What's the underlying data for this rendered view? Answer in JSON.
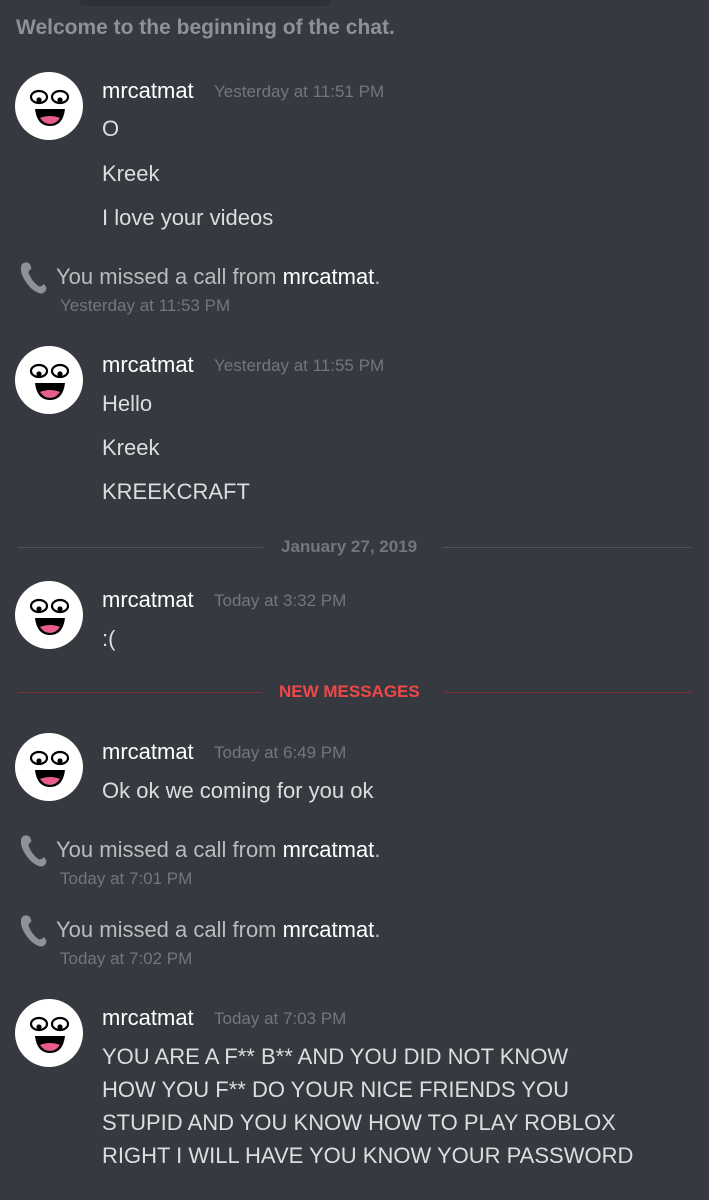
{
  "chat": {
    "welcome": "Welcome to the beginning of the chat."
  },
  "messages": [
    {
      "author": "mrcatmat",
      "timestamp": "Yesterday at 11:51 PM",
      "lines": [
        "O",
        "Kreek",
        "I love your videos"
      ]
    },
    {
      "author": "mrcatmat",
      "timestamp": "Yesterday at 11:55 PM",
      "lines": [
        "Hello",
        "Kreek",
        "KREEKCRAFT"
      ]
    },
    {
      "author": "mrcatmat",
      "timestamp": "Today at 3:32 PM",
      "lines": [
        ":("
      ]
    },
    {
      "author": "mrcatmat",
      "timestamp": "Today at 6:49 PM",
      "lines": [
        "Ok ok we coming for you ok"
      ]
    },
    {
      "author": "mrcatmat",
      "timestamp": "Today at 7:03 PM",
      "lines": [
        "YOU ARE A F** B** AND YOU DID NOT KNOW",
        "HOW YOU F** DO YOUR NICE FRIENDS YOU",
        "STUPID AND YOU KNOW HOW TO PLAY ROBLOX",
        "RIGHT I WILL HAVE YOU KNOW YOUR PASSWORD"
      ]
    }
  ],
  "calls": [
    {
      "prefix": "You missed a call from ",
      "caller": "mrcatmat",
      "suffix": ".",
      "timestamp": "Yesterday at 11:53 PM"
    },
    {
      "prefix": "You missed a call from ",
      "caller": "mrcatmat",
      "suffix": ".",
      "timestamp": "Today at 7:01 PM"
    },
    {
      "prefix": "You missed a call from ",
      "caller": "mrcatmat",
      "suffix": ".",
      "timestamp": "Today at 7:02 PM"
    }
  ],
  "dividers": {
    "date": "January 27, 2019",
    "new_messages": "NEW MESSAGES"
  },
  "colors": {
    "background": "#36393f",
    "new_messages_accent": "#f04747",
    "date_divider": "#4f545c"
  },
  "icons": {
    "avatar": "awesome-face-avatar",
    "missed_call": "phone-icon"
  }
}
